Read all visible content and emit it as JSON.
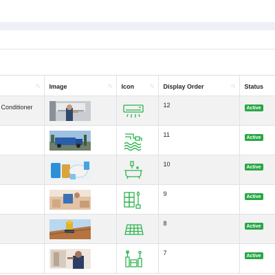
{
  "table": {
    "headers": {
      "image": "Image",
      "icon": "Icon",
      "display_order": "Display Order",
      "status": "Status",
      "sort_glyph": "↑↓"
    },
    "rows": [
      {
        "name": "Air Conditioner",
        "display_order": "12",
        "status": "Active",
        "icon": "air-conditioner-icon",
        "image": "air-conditioner-repair-photo"
      },
      {
        "name": "",
        "display_order": "11",
        "status": "Active",
        "icon": "water-tank-cleaning-icon",
        "image": "tank-cleaning-truck-photo"
      },
      {
        "name": "",
        "display_order": "10",
        "status": "Active",
        "icon": "bathtub-cleaning-icon",
        "image": "cleaning-supplies-photo"
      },
      {
        "name": "",
        "display_order": "9",
        "status": "Active",
        "icon": "tiles-brush-icon",
        "image": "tile-work-photo"
      },
      {
        "name": "",
        "display_order": "8",
        "status": "Active",
        "icon": "roof-tiles-icon",
        "image": "roof-worker-photo"
      },
      {
        "name": "",
        "display_order": "7",
        "status": "Active",
        "icon": "tools-kit-icon",
        "image": "handyman-photo"
      }
    ]
  },
  "colors": {
    "status_active": "#28a745",
    "icon_green": "#2bb24c",
    "stripe": "#f2f2f2"
  }
}
